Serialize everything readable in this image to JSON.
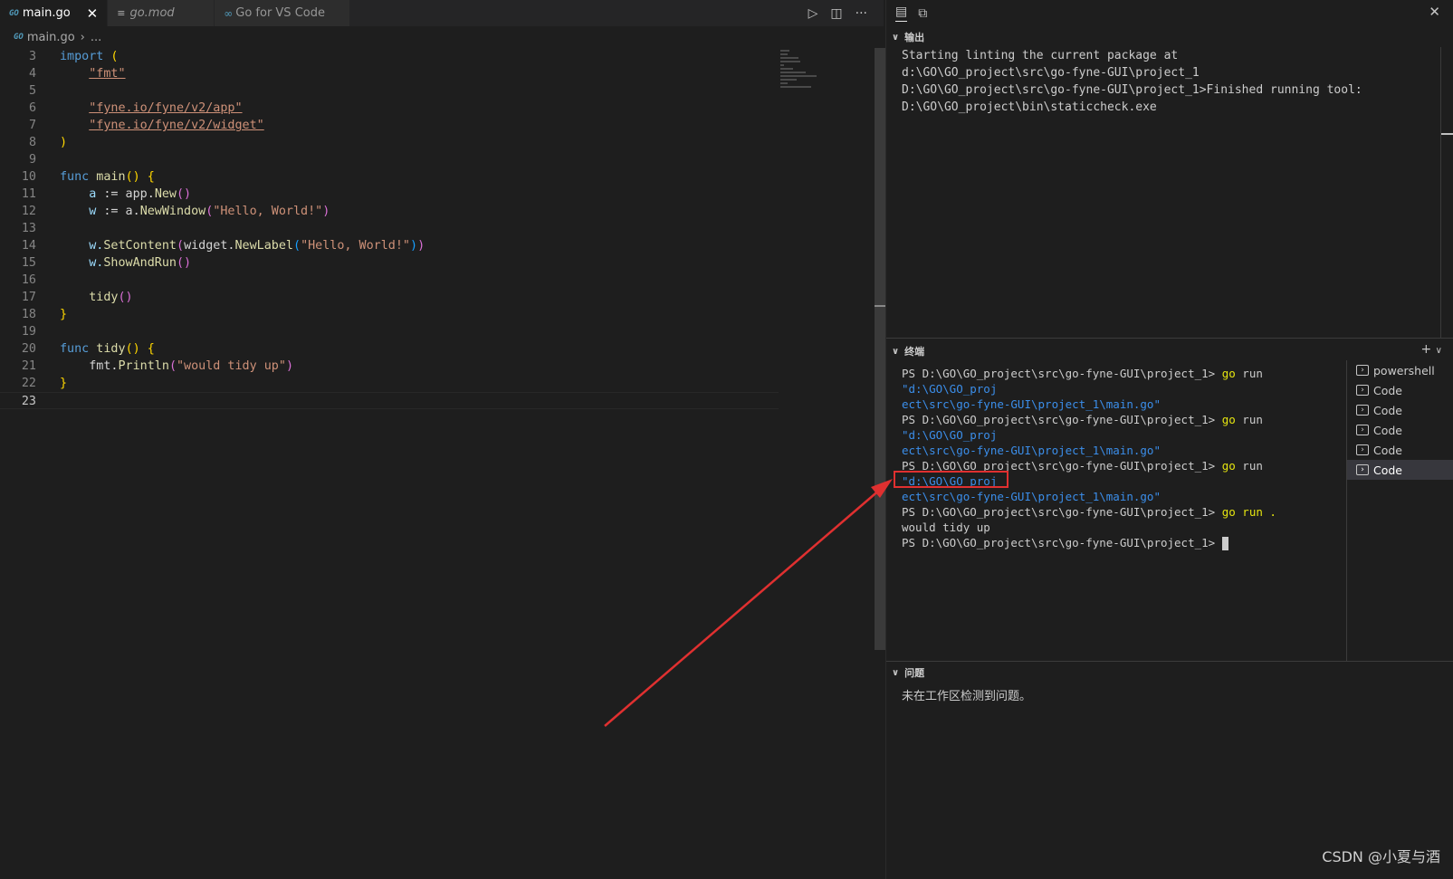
{
  "editor": {
    "tabs": [
      {
        "icon": "GO",
        "label": "main.go",
        "close": "✕"
      },
      {
        "icon": "≡",
        "label": "go.mod"
      },
      {
        "icon": "∞",
        "label": "Go for VS Code"
      }
    ],
    "breadcrumb": {
      "icon": "GO",
      "file": "main.go",
      "rest": "..."
    },
    "line_numbers": [
      "3",
      "4",
      "5",
      "6",
      "7",
      "8",
      "9",
      "10",
      "11",
      "12",
      "13",
      "14",
      "15",
      "16",
      "17",
      "18",
      "19",
      "20",
      "21",
      "22",
      "23"
    ],
    "code": {
      "l3_kw": "import",
      "l3_paren": " (",
      "l4_str": "\"fmt\"",
      "l6_str": "\"fyne.io/fyne/v2/app\"",
      "l7_str": "\"fyne.io/fyne/v2/widget\"",
      "l8_paren": ")",
      "l10_kw": "func",
      "l10_fn": " main",
      "l10_parens": "()",
      "l10_brace": " {",
      "l11_var": "a",
      "l11_op": " := app.",
      "l11_fn": "New",
      "l11_parens": "()",
      "l12_var": "w",
      "l12_op": " := a.",
      "l12_fn": "NewWindow",
      "l12_open": "(",
      "l12_str": "\"Hello, World!\"",
      "l12_close": ")",
      "l14_a": "w.",
      "l14_fn": "SetContent",
      "l14_open": "(",
      "l14_b": "widget.",
      "l14_fn2": "NewLabel",
      "l14_open2": "(",
      "l14_str": "\"Hello, World!\"",
      "l14_close2": ")",
      "l14_close": ")",
      "l15_a": "w.",
      "l15_fn": "ShowAndRun",
      "l15_parens": "()",
      "l17_fn": "tidy",
      "l17_parens": "()",
      "l18_brace": "}",
      "l20_kw": "func",
      "l20_fn": " tidy",
      "l20_parens": "()",
      "l20_brace": " {",
      "l21_a": "fmt.",
      "l21_fn": "Println",
      "l21_open": "(",
      "l21_str": "\"would tidy up\"",
      "l21_close": ")",
      "l22_brace": "}"
    }
  },
  "panel": {
    "output_header": "输出",
    "output_lines": [
      "Starting linting the current package at",
      "d:\\GO\\GO_project\\src\\go-fyne-GUI\\project_1",
      "D:\\GO\\GO_project\\src\\go-fyne-GUI\\project_1>Finished running tool:",
      "D:\\GO\\GO_project\\bin\\staticcheck.exe"
    ],
    "terminal_header": "终端",
    "terminal": {
      "prompt": "PS D:\\GO\\GO_project\\src\\go-fyne-GUI\\project_1> ",
      "cmd_go": "go",
      "cmd_run": " run ",
      "path_a": "\"d:\\GO\\GO_proj",
      "path_b": "ect\\src\\go-fyne-GUI\\project_1\\main.go\"",
      "run_dot": "go run .",
      "output": "would tidy up"
    },
    "terminal_list": [
      "powershell",
      "Code",
      "Code",
      "Code",
      "Code",
      "Code"
    ],
    "problems_header": "问题",
    "problems_text": "未在工作区检测到问题。"
  },
  "watermark": "CSDN @小夏与酒",
  "colors": {
    "annotation": "#e03030",
    "accent": "#519aba"
  }
}
